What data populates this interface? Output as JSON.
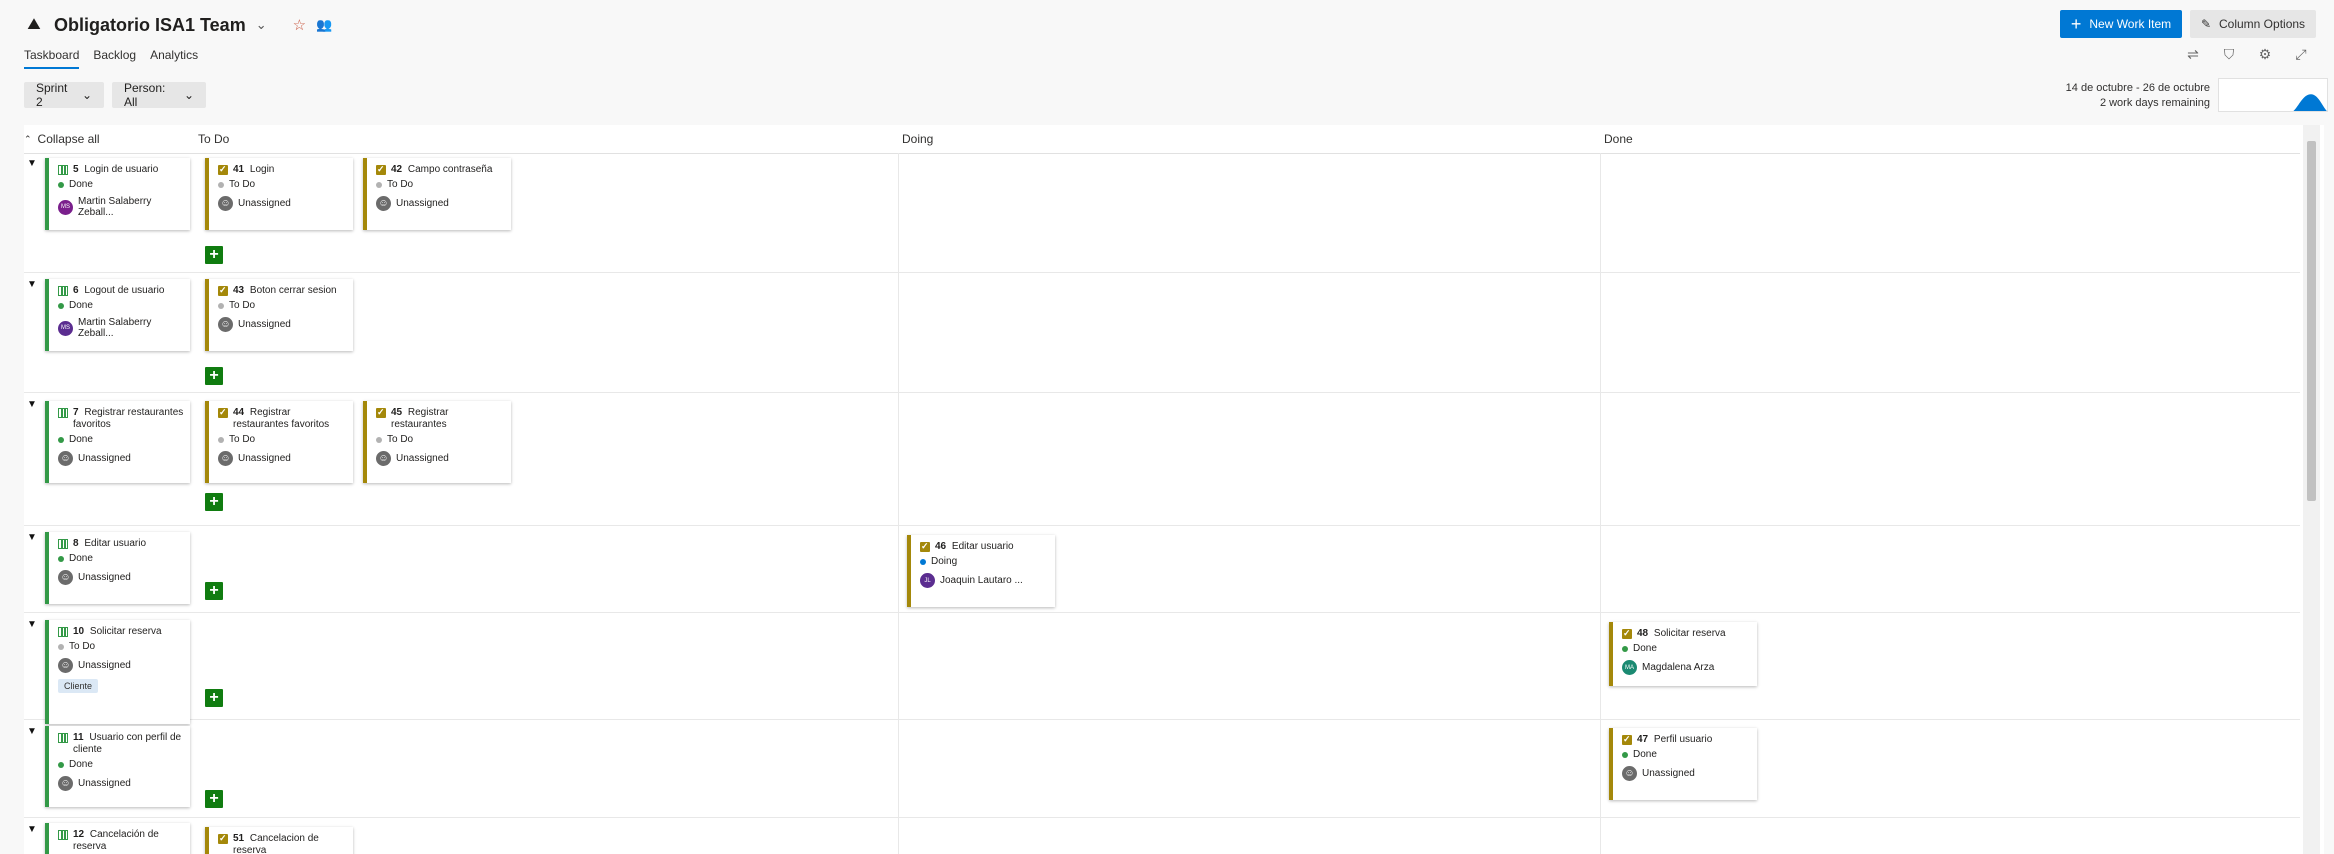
{
  "header": {
    "team_name": "Obligatorio ISA1 Team",
    "new_work_item": "New Work Item",
    "column_options": "Column Options"
  },
  "tabs": [
    "Taskboard",
    "Backlog",
    "Analytics"
  ],
  "filters": {
    "sprint": "Sprint 2",
    "person": "Person: All"
  },
  "sprint_info": {
    "dates": "14 de octubre - 26 de octubre",
    "remaining": "2 work days remaining"
  },
  "burndown_remaining_fraction": 0.55,
  "board": {
    "collapse_all": "Collapse all",
    "columns": [
      "To Do",
      "Doing",
      "Done"
    ]
  },
  "rows": [
    {
      "story": {
        "id": "5",
        "title": "Login de usuario",
        "state": "Done",
        "assignee": "Martin Salaberry Zeball...",
        "initials": "MS"
      },
      "todo": [
        {
          "id": "41",
          "title": "Login",
          "state": "To Do",
          "assignee": "Unassigned"
        },
        {
          "id": "42",
          "title": "Campo contraseña",
          "state": "To Do",
          "assignee": "Unassigned"
        }
      ],
      "doing": [],
      "done": []
    },
    {
      "story": {
        "id": "6",
        "title": "Logout de usuario",
        "state": "Done",
        "assignee": "Martin Salaberry Zeball...",
        "initials": "MS"
      },
      "todo": [
        {
          "id": "43",
          "title": "Boton cerrar sesion",
          "state": "To Do",
          "assignee": "Unassigned"
        }
      ],
      "doing": [],
      "done": []
    },
    {
      "story": {
        "id": "7",
        "title": "Registrar restaurantes favoritos",
        "state": "Done",
        "assignee": "Unassigned"
      },
      "todo": [
        {
          "id": "44",
          "title": "Registrar restaurantes favoritos",
          "state": "To Do",
          "assignee": "Unassigned"
        },
        {
          "id": "45",
          "title": "Registrar restaurantes",
          "state": "To Do",
          "assignee": "Unassigned"
        }
      ],
      "doing": [],
      "done": []
    },
    {
      "story": {
        "id": "8",
        "title": "Editar usuario",
        "state": "Done",
        "assignee": "Unassigned"
      },
      "todo": [],
      "doing": [
        {
          "id": "46",
          "title": "Editar usuario",
          "state": "Doing",
          "assignee": "Joaquin Lautaro ...",
          "initials": "JL"
        }
      ],
      "done": []
    },
    {
      "story": {
        "id": "10",
        "title": "Solicitar reserva",
        "state": "To Do",
        "assignee": "Unassigned",
        "tag": "Cliente"
      },
      "todo": [],
      "doing": [],
      "done": [
        {
          "id": "48",
          "title": "Solicitar reserva",
          "state": "Done",
          "assignee": "Magdalena Arza",
          "initials": "MA"
        }
      ]
    },
    {
      "story": {
        "id": "11",
        "title": "Usuario con perfil de cliente",
        "state": "Done",
        "assignee": "Unassigned"
      },
      "todo": [],
      "doing": [],
      "done": [
        {
          "id": "47",
          "title": "Perfil usuario",
          "state": "Done",
          "assignee": "Unassigned"
        }
      ]
    },
    {
      "story": {
        "id": "12",
        "title": "Cancelación de reserva",
        "state": "",
        "assignee": ""
      },
      "todo": [
        {
          "id": "51",
          "title": "Cancelacion de reserva",
          "state": "",
          "assignee": ""
        }
      ],
      "doing": [],
      "done": []
    }
  ],
  "colors": {
    "accent": "#0078d4",
    "story": "#339947",
    "task": "#a4880a",
    "state_done": "#339947",
    "state_todo": "#b2b2b2",
    "state_doing": "#0078d4",
    "add_button": "#107c10"
  },
  "icons": {
    "team": "team-icon",
    "favorite": "star-icon",
    "members": "people-icon",
    "toolbar": [
      "settings-sliders-icon",
      "filter-icon",
      "gear-icon",
      "fullscreen-icon"
    ]
  }
}
